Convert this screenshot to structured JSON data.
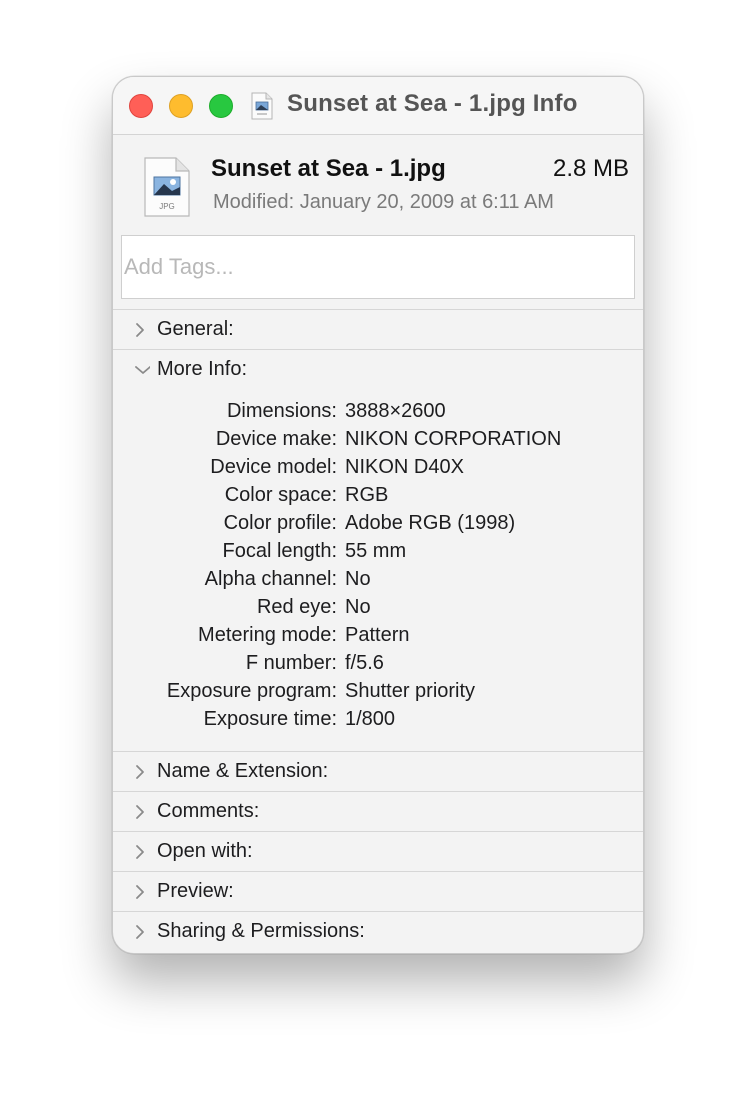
{
  "window": {
    "title": "Sunset at Sea - 1.jpg Info",
    "traffic_lights": {
      "close": "#ff5f57",
      "minimize": "#febc2e",
      "zoom": "#28c840"
    }
  },
  "header": {
    "file_name": "Sunset at Sea - 1.jpg",
    "file_size": "2.8 MB",
    "modified": "Modified: January 20, 2009 at 6:11 AM",
    "icon_label": "JPG",
    "icon": "jpg-file-icon"
  },
  "tags": {
    "placeholder": "Add Tags...",
    "value": ""
  },
  "sections": {
    "general": {
      "label": "General:",
      "expanded": false
    },
    "more_info": {
      "label": "More Info:",
      "expanded": true,
      "rows": [
        {
          "key": "Dimensions:",
          "value": "3888×2600"
        },
        {
          "key": "Device make:",
          "value": "NIKON CORPORATION"
        },
        {
          "key": "Device model:",
          "value": "NIKON D40X"
        },
        {
          "key": "Color space:",
          "value": "RGB"
        },
        {
          "key": "Color profile:",
          "value": "Adobe RGB (1998)"
        },
        {
          "key": "Focal length:",
          "value": "55 mm"
        },
        {
          "key": "Alpha channel:",
          "value": "No"
        },
        {
          "key": "Red eye:",
          "value": "No"
        },
        {
          "key": "Metering mode:",
          "value": "Pattern"
        },
        {
          "key": "F number:",
          "value": "f/5.6"
        },
        {
          "key": "Exposure program:",
          "value": "Shutter priority"
        },
        {
          "key": "Exposure time:",
          "value": "1/800"
        }
      ]
    },
    "name_extension": {
      "label": "Name & Extension:",
      "expanded": false
    },
    "comments": {
      "label": "Comments:",
      "expanded": false
    },
    "open_with": {
      "label": "Open with:",
      "expanded": false
    },
    "preview": {
      "label": "Preview:",
      "expanded": false
    },
    "sharing": {
      "label": "Sharing & Permissions:",
      "expanded": false
    }
  }
}
